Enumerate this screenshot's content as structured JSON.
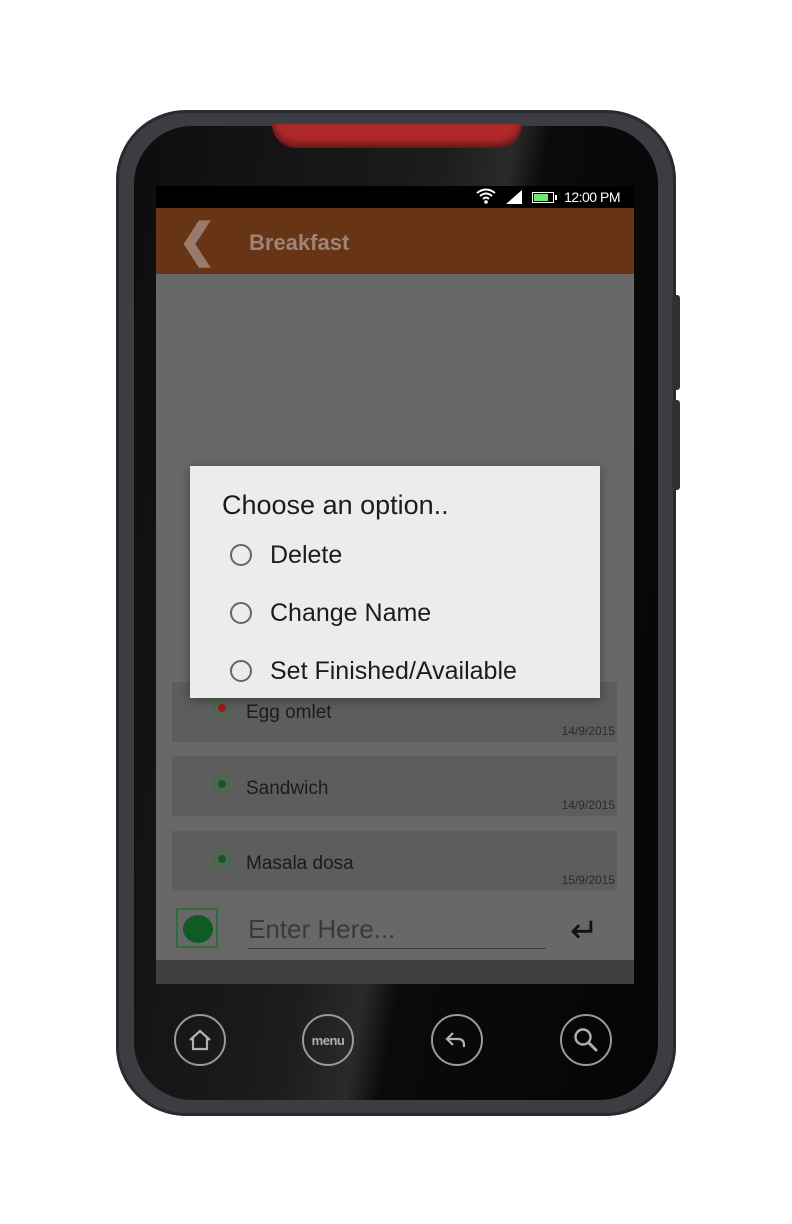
{
  "status_bar": {
    "time": "12:00 PM",
    "icons": [
      "wifi-icon",
      "signal-icon",
      "battery-icon"
    ]
  },
  "app_bar": {
    "back_icon": "chevron-left-icon",
    "title": "Breakfast"
  },
  "dialog": {
    "title": "Choose an option..",
    "options": [
      {
        "label": "Delete",
        "selected": false
      },
      {
        "label": "Change Name",
        "selected": false
      },
      {
        "label": "Set Finished/Available",
        "selected": false
      }
    ]
  },
  "items": [
    {
      "name": "Egg omlet",
      "date": "14/9/2015",
      "status_color": "#a01818"
    },
    {
      "name": "Sandwich",
      "date": "14/9/2015",
      "status_color": "#0f5a26"
    },
    {
      "name": "Masala dosa",
      "date": "15/9/2015",
      "status_color": "#0f5a26"
    }
  ],
  "input": {
    "placeholder": "Enter Here...",
    "value": "",
    "enter_icon": "enter-arrow-icon",
    "status_color": "#0f5a26"
  },
  "nav_buttons": [
    {
      "name": "home-icon"
    },
    {
      "name": "menu-button",
      "label": "menu"
    },
    {
      "name": "back-arrow-icon"
    },
    {
      "name": "search-icon"
    }
  ],
  "colors": {
    "app_bar": "#673416",
    "accent_green": "#0f5a26",
    "accent_red": "#a01818",
    "phone_frame": "#3c3d42"
  }
}
